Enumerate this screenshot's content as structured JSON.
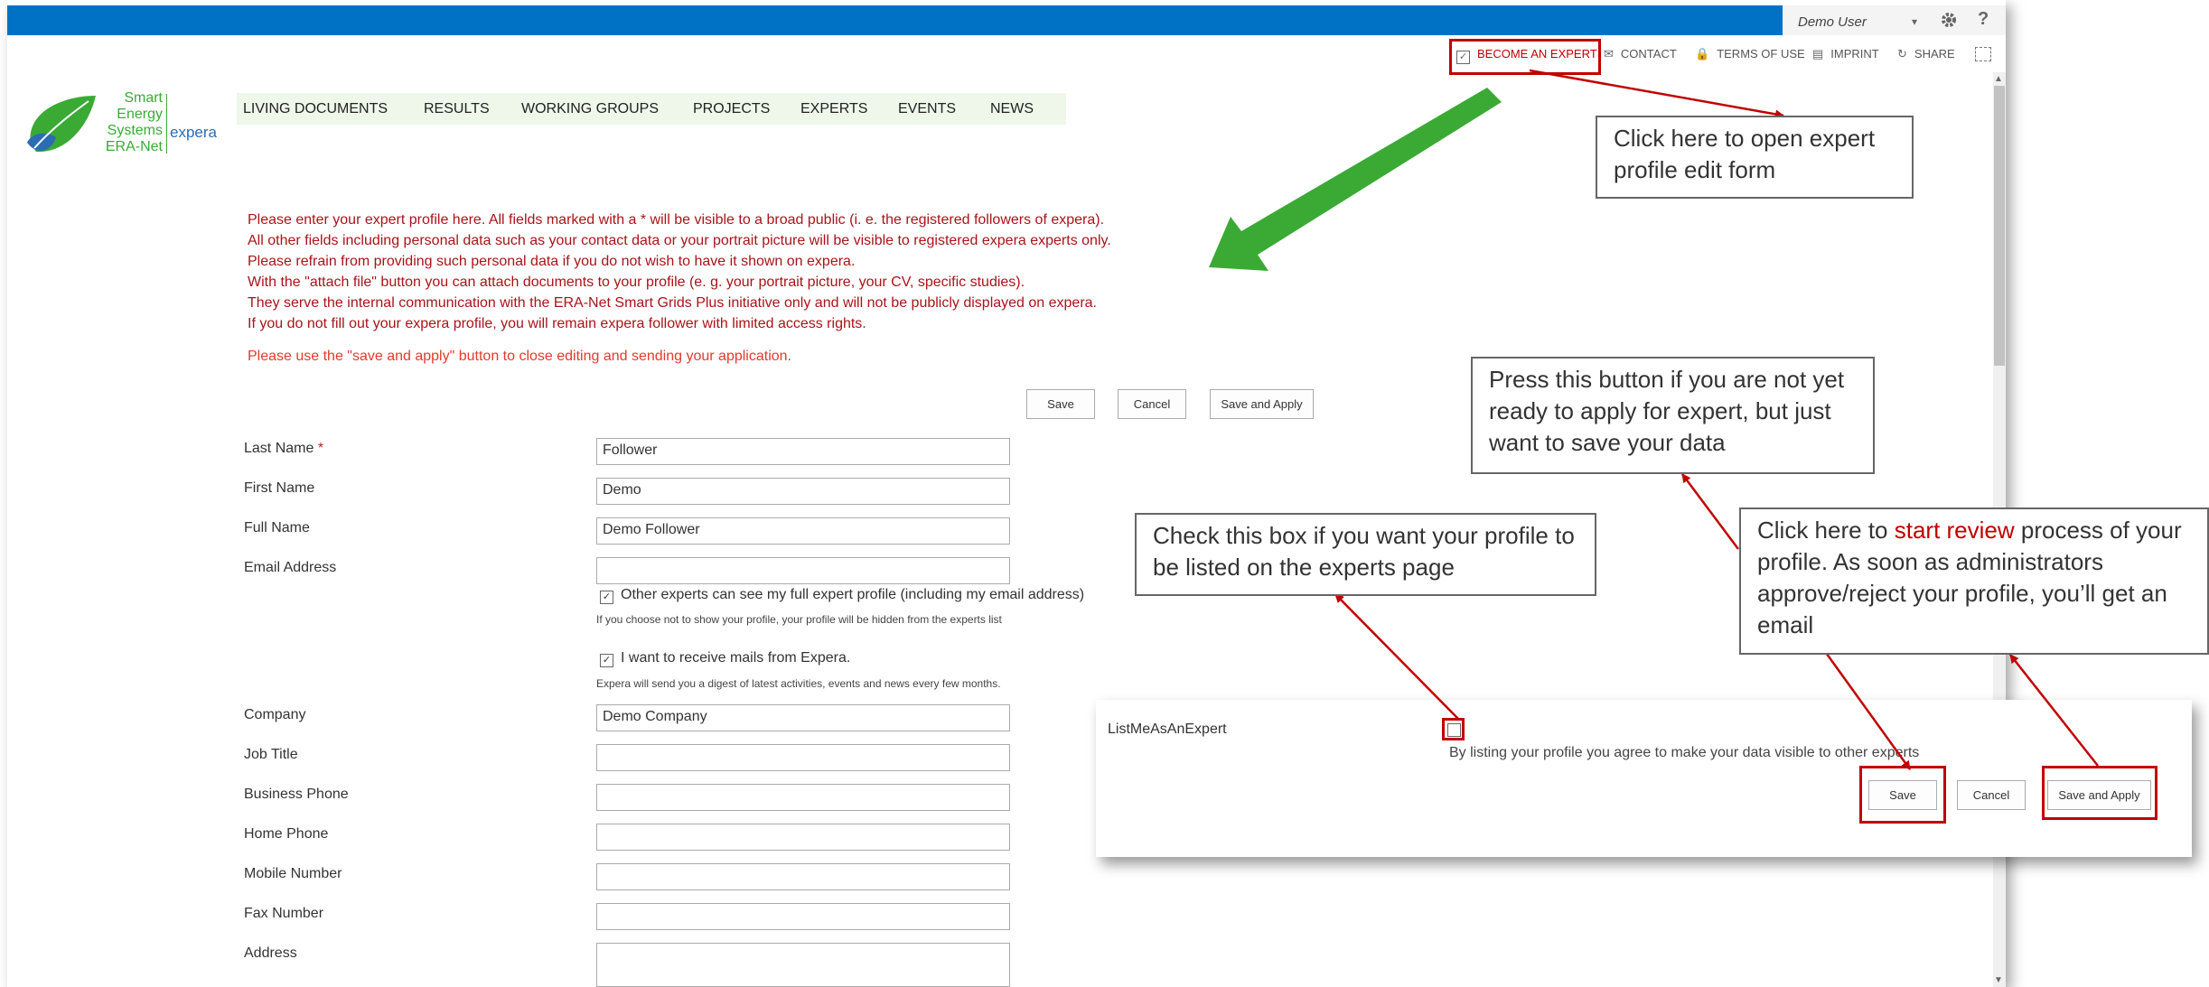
{
  "suite_bar": {
    "user_name": "Demo User",
    "menu_arrow": "▾",
    "gear_icon": "gear-icon",
    "help_label": "?"
  },
  "top_links": {
    "become_expert": "BECOME AN EXPERT",
    "contact": "CONTACT",
    "terms": "TERMS OF USE",
    "imprint": "IMPRINT",
    "share": "SHARE"
  },
  "logo": {
    "line1": "Smart",
    "line2": "Energy",
    "line3": "Systems",
    "line4": "ERA-Net",
    "brand": "expera"
  },
  "nav": {
    "items": [
      "LIVING DOCUMENTS",
      "RESULTS",
      "WORKING GROUPS",
      "PROJECTS",
      "EXPERTS",
      "EVENTS",
      "NEWS"
    ]
  },
  "intro": {
    "lines": [
      "Please enter your expert profile here. All fields marked with a * will be visible to a broad public (i. e. the registered followers of expera).",
      "All other fields including personal data such as your contact data or your portrait picture will be visible to registered expera experts only.",
      "Please refrain from providing such personal data if you do not wish to have it shown on expera.",
      "With the \"attach file\" button you can attach documents to your profile (e. g. your portrait picture, your CV, specific studies).",
      "They serve the internal communication with the ERA-Net Smart Grids Plus initiative only and will not be publicly displayed on expera.",
      "If you do not fill out your expera profile, you will remain expera follower with limited access rights."
    ],
    "note": "Please use the \"save and apply\" button to close editing and sending your application."
  },
  "form_buttons": {
    "save": "Save",
    "cancel": "Cancel",
    "save_apply": "Save and Apply"
  },
  "fields": {
    "last_name": {
      "label": "Last Name",
      "required": " *",
      "value": "Follower"
    },
    "first_name": {
      "label": "First Name",
      "value": "Demo"
    },
    "full_name": {
      "label": "Full Name",
      "value": "Demo Follower"
    },
    "email": {
      "label": "Email Address",
      "value": ""
    },
    "company": {
      "label": "Company",
      "value": "Demo Company"
    },
    "job_title": {
      "label": "Job Title",
      "value": ""
    },
    "business_phone": {
      "label": "Business Phone",
      "value": ""
    },
    "home_phone": {
      "label": "Home Phone",
      "value": ""
    },
    "mobile": {
      "label": "Mobile Number",
      "value": ""
    },
    "fax": {
      "label": "Fax Number",
      "value": ""
    },
    "address": {
      "label": "Address",
      "value": ""
    }
  },
  "checkboxes": {
    "show_profile": {
      "label": "Other experts can see my full expert profile (including my email address)",
      "hint": "If you choose not to show your profile, your profile will be hidden from the experts list",
      "checked": true
    },
    "receive_mails": {
      "label": "I want to receive mails from Expera.",
      "hint": "Expera will send you a digest of latest activities, events and news every few months.",
      "checked": true
    }
  },
  "panel": {
    "field_label": "ListMeAsAnExpert",
    "agreement": "By listing your profile you agree to make your data visible to other experts",
    "save": "Save",
    "cancel": "Cancel",
    "save_apply": "Save and Apply"
  },
  "callouts": {
    "open_form": "Click here to open expert profile edit form",
    "save_hint": "Press this button if you are not yet ready to apply for expert, but just want to save your data",
    "checkbox_hint": "Check this box if you want your profile to be listed on the experts page",
    "review_prefix": "Click here to ",
    "review_highlight": "start review",
    "review_suffix": " process of your profile. As soon as administrators approve/reject your profile, you’ll get an email"
  },
  "colors": {
    "suite_blue": "#0072c6",
    "nav_bg": "#eef7ea",
    "intro_red": "#a8141a",
    "annotation_red": "#c00000",
    "arrow_green": "#3aaa35"
  }
}
